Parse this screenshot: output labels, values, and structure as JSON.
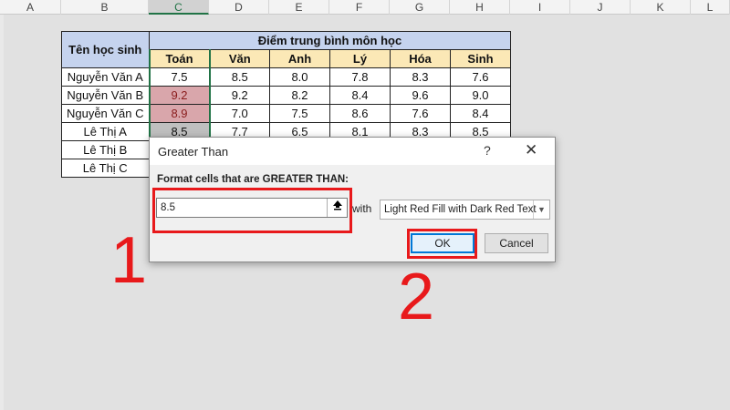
{
  "columns": [
    "A",
    "B",
    "C",
    "D",
    "E",
    "F",
    "G",
    "H",
    "I",
    "J",
    "K",
    "L"
  ],
  "table": {
    "name_header": "Tên học sinh",
    "group_header": "Điểm trung bình môn học",
    "subjects": [
      "Toán",
      "Văn",
      "Anh",
      "Lý",
      "Hóa",
      "Sinh"
    ],
    "rows": [
      {
        "name": "Nguyễn Văn A",
        "scores": [
          "7.5",
          "8.5",
          "8.0",
          "7.8",
          "8.3",
          "7.6"
        ]
      },
      {
        "name": "Nguyễn Văn B",
        "scores": [
          "9.2",
          "9.2",
          "8.2",
          "8.4",
          "9.6",
          "9.0"
        ]
      },
      {
        "name": "Nguyễn Văn C",
        "scores": [
          "8.9",
          "7.0",
          "7.5",
          "8.6",
          "7.6",
          "8.4"
        ]
      },
      {
        "name": "Lê Thị A",
        "scores": [
          "8.5",
          "7.7",
          "6.5",
          "8.1",
          "8.3",
          "8.5"
        ]
      },
      {
        "name": "Lê Thị B",
        "scores": [
          "",
          "",
          "",
          "",
          "",
          ""
        ]
      },
      {
        "name": "Lê Thị C",
        "scores": [
          "",
          "",
          "",
          "",
          "",
          ""
        ]
      }
    ]
  },
  "dialog": {
    "title": "Greater Than",
    "help": "?",
    "close": "✕",
    "prompt": "Format cells that are GREATER THAN:",
    "value": "8.5",
    "with_label": "with",
    "format_option": "Light Red Fill with Dark Red Text",
    "ok_label": "OK",
    "cancel_label": "Cancel"
  },
  "annotations": {
    "step1": "1",
    "step2": "2",
    "color": "#e8191b"
  },
  "colors": {
    "highlight_fill": "#d9a6ab",
    "highlight_text": "#8a1c1c",
    "header_blue": "#c5d3ee",
    "header_yellow": "#fbe8b6",
    "excel_green": "#217346"
  }
}
